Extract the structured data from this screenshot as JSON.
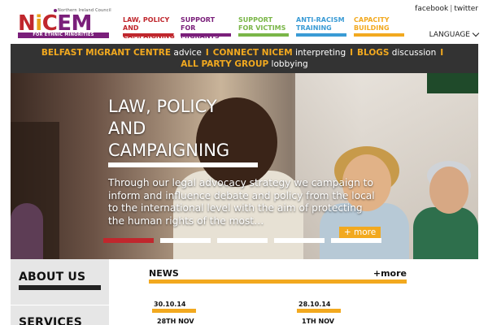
{
  "brand": {
    "tagline": "Northern Ireland Council",
    "wordmark": [
      "N",
      "i",
      "C",
      "E",
      "M"
    ],
    "subbar": "FOR ETHNIC MINORITIES",
    "colors": {
      "red": "#c0272d",
      "purple": "#7a1f7a",
      "orange": "#e8a21b"
    }
  },
  "nav": [
    {
      "label": "LAW, POLICY AND CAMPAIGNING",
      "color": "#c0272d",
      "text_color": "#c0272d"
    },
    {
      "label": "SUPPORT FOR MIGRANTS",
      "color": "#7a1f7a",
      "text_color": "#7a1f7a"
    },
    {
      "label": "SUPPORT FOR VICTIMS",
      "color": "#7ab648",
      "text_color": "#7ab648"
    },
    {
      "label": "ANTI-RACISM TRAINING",
      "color": "#3a9bd5",
      "text_color": "#3a9bd5"
    },
    {
      "label": "CAPACITY BUILDING",
      "color": "#f2a91f",
      "text_color": "#f2a91f"
    }
  ],
  "social": {
    "facebook": "facebook",
    "separator": "|",
    "twitter": "twitter"
  },
  "language": {
    "label": "LANGUAGE",
    "icon": "chevron-down-icon"
  },
  "links_bar": {
    "line1": [
      {
        "highlight": "BELFAST MIGRANT CENTRE",
        "text": " advice"
      },
      {
        "highlight": "CONNECT NICEM",
        "text": " interpreting"
      },
      {
        "highlight": "BLOGS",
        "text": " discussion"
      }
    ],
    "line2": {
      "highlight": "ALL PARTY GROUP",
      "text": " lobbying"
    },
    "separator": "I"
  },
  "hero": {
    "title": "LAW, POLICY\nAND\nCAMPAIGNING",
    "text": "Through our legal advocacy strategy we campaign to inform and influence debate and policy from the local to the international level with the aim of protecting the human rights of the most…",
    "more_label": "+ more",
    "slides_count": 5,
    "active_slide": 0
  },
  "sidebar": {
    "items": [
      {
        "label": "ABOUT US"
      },
      {
        "label": "SERVICES"
      }
    ]
  },
  "news": {
    "title": "NEWS",
    "more": "+more",
    "items": [
      {
        "date": "30.10.14",
        "title": "28TH NOV"
      },
      {
        "date": "28.10.14",
        "title": "1TH NOV"
      }
    ]
  }
}
